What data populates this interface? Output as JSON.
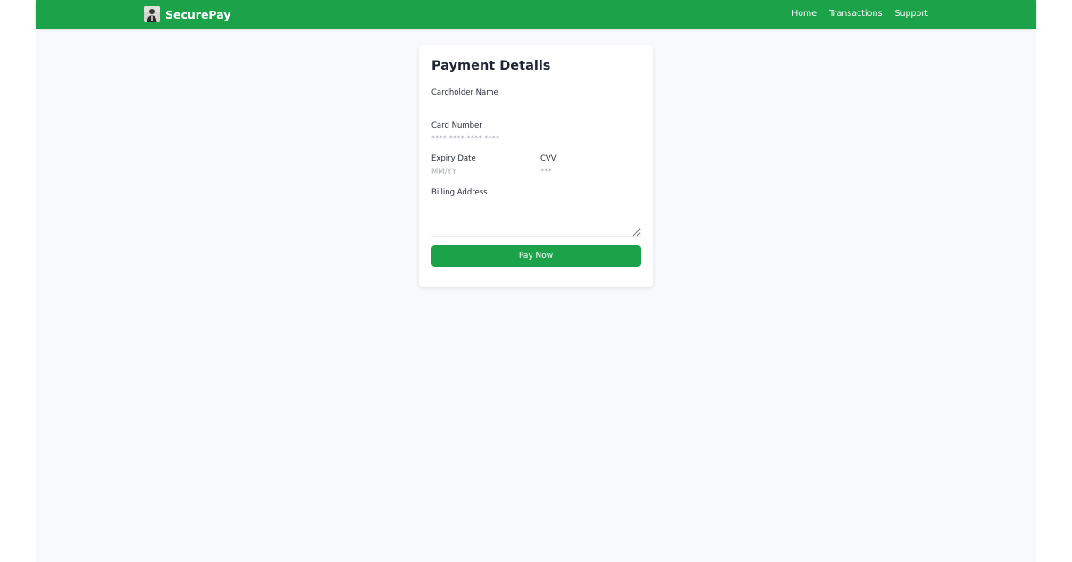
{
  "navbar": {
    "brand_name": "SecurePay",
    "brand_logo": "person-avatar-logo",
    "links": [
      {
        "label": "Home"
      },
      {
        "label": "Transactions"
      },
      {
        "label": "Support"
      }
    ]
  },
  "form": {
    "title": "Payment Details",
    "cardholder_name": {
      "label": "Cardholder Name",
      "value": "",
      "placeholder": ""
    },
    "card_number": {
      "label": "Card Number",
      "value": "",
      "placeholder": "**** **** **** ****"
    },
    "expiry_date": {
      "label": "Expiry Date",
      "value": "",
      "placeholder": "MM/YY"
    },
    "cvv": {
      "label": "CVV",
      "value": "",
      "placeholder": "***"
    },
    "billing_address": {
      "label": "Billing Address",
      "value": ""
    },
    "submit_label": "Pay Now"
  },
  "colors": {
    "accent": "#1ca34a",
    "background": "#f8f9fb",
    "card": "#ffffff",
    "title_text": "#1f2533"
  }
}
